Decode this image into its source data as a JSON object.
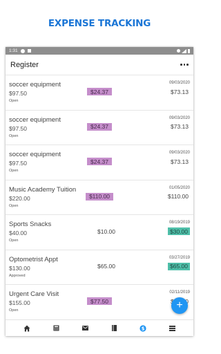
{
  "banner": {
    "title": "EXPENSE TRACKING"
  },
  "status_bar": {
    "time": "1:31"
  },
  "app_bar": {
    "title": "Register"
  },
  "rows": [
    {
      "name": "soccer equipment",
      "amount": "$97.50",
      "status": "Open",
      "date": "09/03/2020",
      "middle": "$24.37",
      "middle_highlight": true,
      "right": "$73.13",
      "right_highlight": false
    },
    {
      "name": "soccer equipment",
      "amount": "$97.50",
      "status": "Open",
      "date": "09/03/2020",
      "middle": "$24.37",
      "middle_highlight": true,
      "right": "$73.13",
      "right_highlight": false
    },
    {
      "name": "soccer equipment",
      "amount": "$97.50",
      "status": "Open",
      "date": "09/03/2020",
      "middle": "$24.37",
      "middle_highlight": true,
      "right": "$73.13",
      "right_highlight": false
    },
    {
      "name": "Music Academy Tuition",
      "amount": "$220.00",
      "status": "Open",
      "date": "01/05/2020",
      "middle": "$110.00",
      "middle_highlight": true,
      "right": "$110.00",
      "right_highlight": false
    },
    {
      "name": "Sports Snacks",
      "amount": "$40.00",
      "status": "Open",
      "date": "08/19/2019",
      "middle": "$10.00",
      "middle_highlight": false,
      "right": "$30.00",
      "right_highlight": true
    },
    {
      "name": "Optometrist Appt",
      "amount": "$130.00",
      "status": "Approved",
      "date": "03/27/2019",
      "middle": "$65.00",
      "middle_highlight": false,
      "right": "$65.00",
      "right_highlight": true
    },
    {
      "name": "Urgent Care Visit",
      "amount": "$155.00",
      "status": "Open",
      "date": "02/11/2019",
      "middle": "$77.50",
      "middle_highlight": true,
      "right": "$77.50",
      "right_highlight": false
    }
  ],
  "fab": {
    "label": "+"
  },
  "nav": [
    {
      "icon": "home-icon"
    },
    {
      "icon": "calculator-icon"
    },
    {
      "icon": "mail-icon"
    },
    {
      "icon": "book-icon"
    },
    {
      "icon": "dollar-icon",
      "active": true
    },
    {
      "icon": "list-icon"
    }
  ],
  "colors": {
    "accent": "#2196f3",
    "purple_highlight": "#c58ecb",
    "green_highlight": "#4fbfa9",
    "banner": "#1b76d6"
  }
}
